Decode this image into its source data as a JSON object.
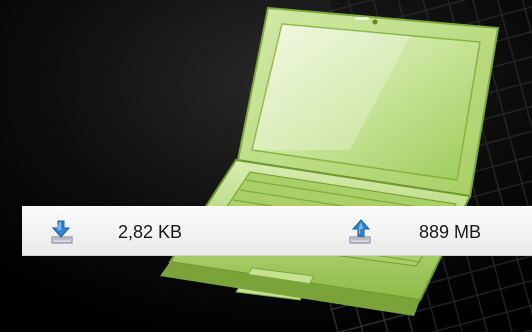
{
  "traffic": {
    "received": {
      "icon": "download-arrow-icon",
      "value": "2,82 KB"
    },
    "sent": {
      "icon": "upload-arrow-icon",
      "value": "889 MB"
    }
  },
  "colors": {
    "background": "#000000",
    "laptop_green": "#b6d87a",
    "laptop_dark_green": "#6f9a2e",
    "arrow_blue": "#2f86d6",
    "bar_background": "#f2f2f2"
  }
}
